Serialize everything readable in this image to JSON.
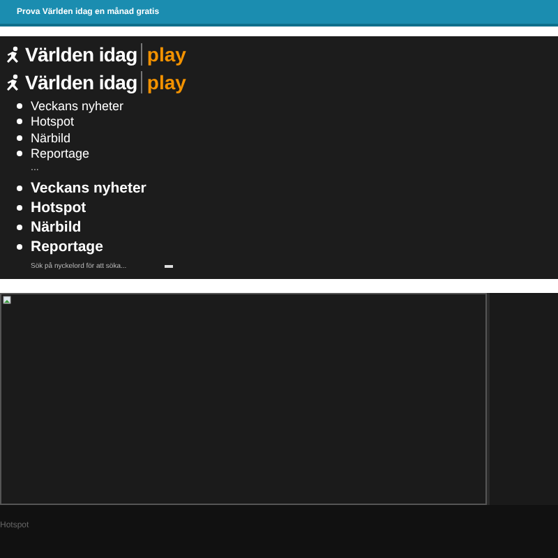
{
  "banner": {
    "text": "Prova Världen idag en månad gratis"
  },
  "logos": [
    {
      "brand": "Världen idag",
      "product": "play"
    },
    {
      "brand": "Världen idag",
      "product": "play"
    }
  ],
  "nav_small": [
    "Veckans nyheter",
    "Hotspot",
    "Närbild",
    "Reportage"
  ],
  "more": "...",
  "nav_large": [
    "Veckans nyheter",
    "Hotspot",
    "Närbild",
    "Reportage"
  ],
  "search": {
    "placeholder": "Sök på nyckelord för att söka..."
  },
  "footer": {
    "text": "Hotspot"
  }
}
